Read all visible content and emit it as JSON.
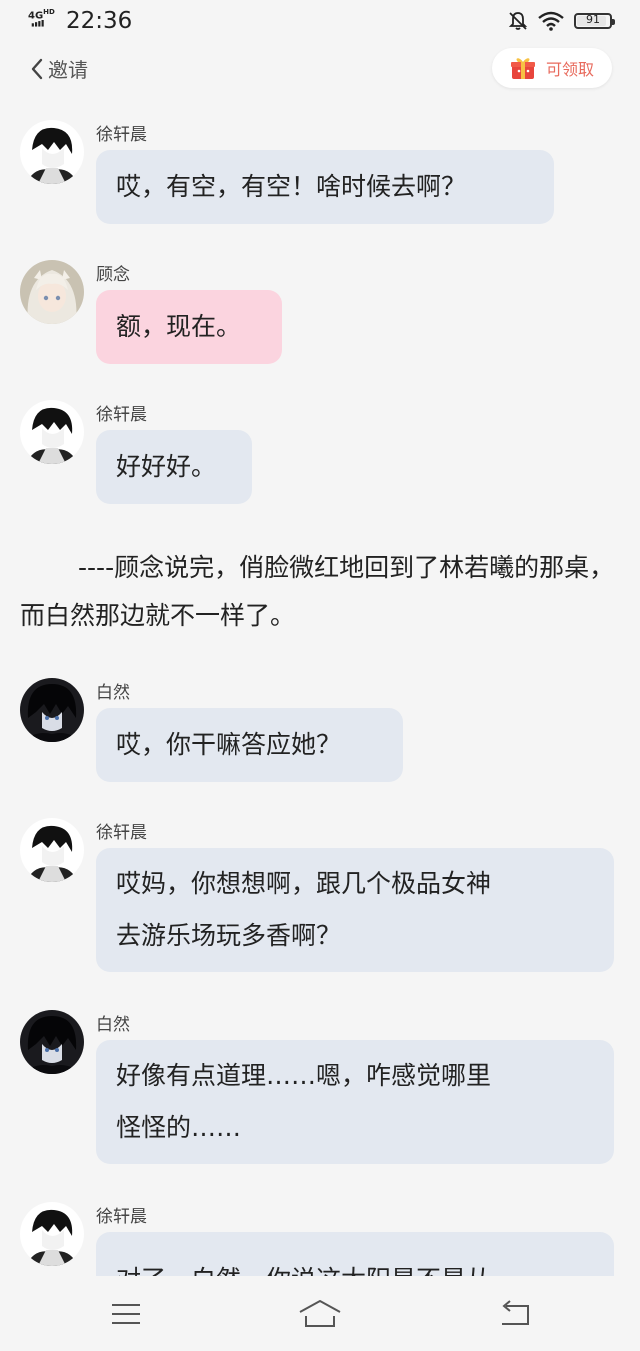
{
  "status": {
    "network": "4G HD",
    "time": "22:36",
    "battery": "91",
    "battery_level": 0.91
  },
  "header": {
    "back_label": "邀请",
    "claim_label": "可领取"
  },
  "messages": [
    {
      "sender": "徐轩晨",
      "avatar": "boy-avatar",
      "text": "哎，有空，有空！啥时候去啊？"
    },
    {
      "sender": "顾念",
      "avatar": "girl-avatar",
      "text": "额，现在。"
    },
    {
      "sender": "徐轩晨",
      "avatar": "boy-avatar",
      "text": "好好好。"
    },
    {
      "sender": "白然",
      "avatar": "dark-boy-avatar",
      "text": "哎，你干嘛答应她？"
    },
    {
      "sender": "徐轩晨",
      "avatar": "boy-avatar",
      "line1": "哎妈，你想想啊，跟几个极品女神",
      "line2": "去游乐场玩多香啊？"
    },
    {
      "sender": "白然",
      "avatar": "dark-boy-avatar",
      "line1": "好像有点道理……嗯，咋感觉哪里",
      "line2": "怪怪的……"
    },
    {
      "sender": "徐轩晨",
      "avatar": "boy-avatar",
      "text": "对了，白然，你说这太阳是不是从"
    }
  ],
  "narration": "----顾念说完，俏脸微红地回到了林若曦的那桌，而白然那边就不一样了。",
  "colors": {
    "bubble_default": "#e3e8f0",
    "bubble_pink": "#fbd4df",
    "accent": "#e86a5c"
  }
}
